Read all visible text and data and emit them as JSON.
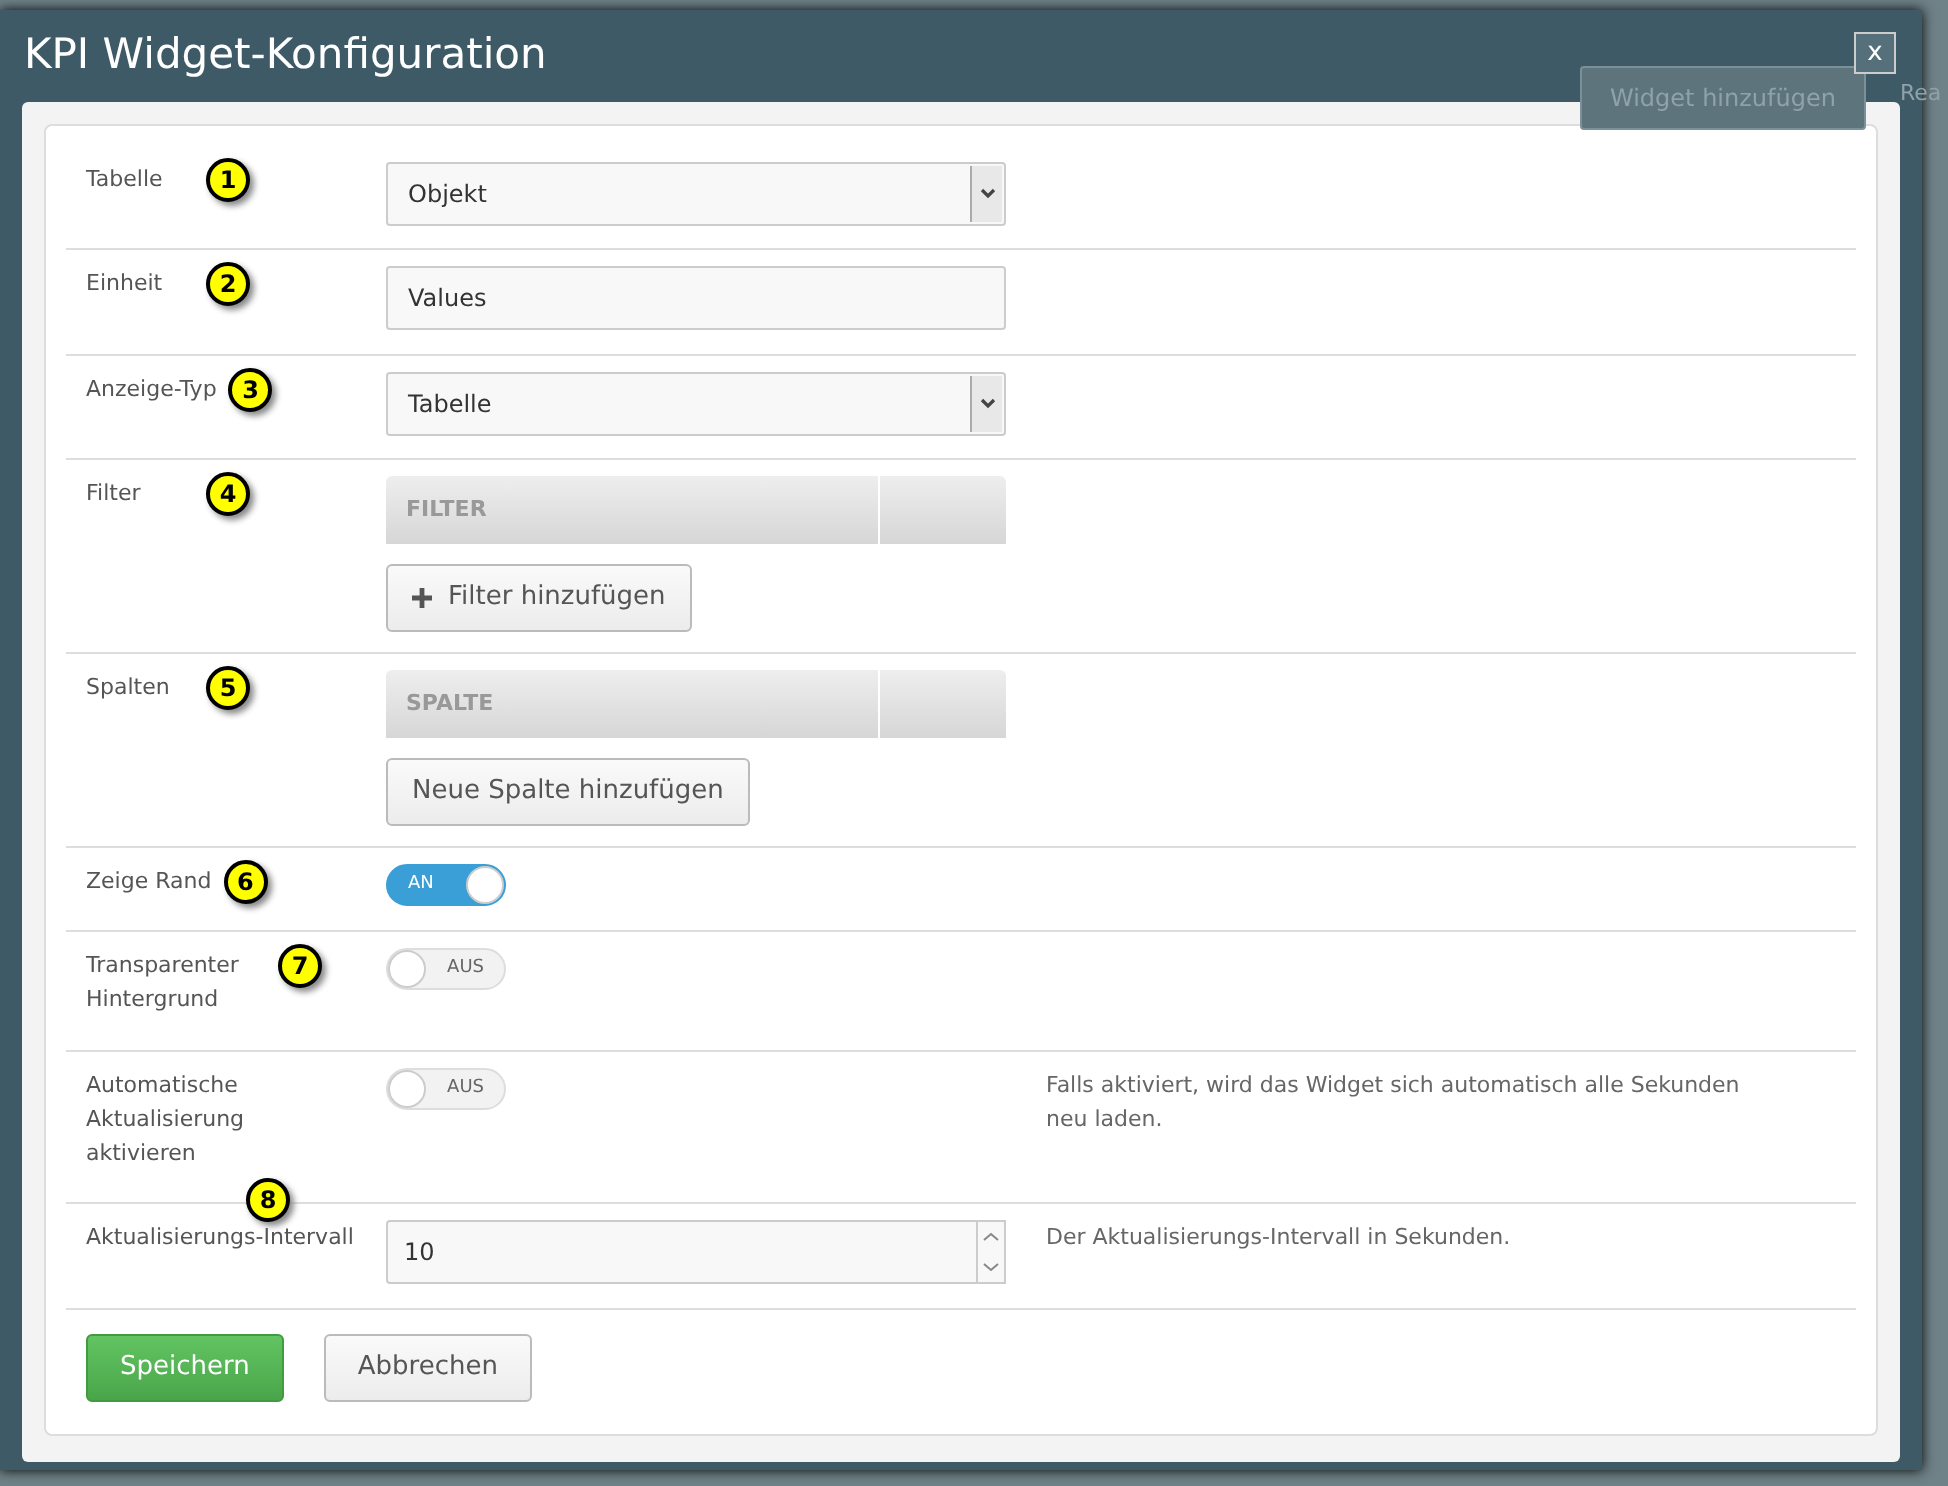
{
  "window": {
    "title": "KPI Widget-Konfiguration",
    "close": "x"
  },
  "background": {
    "button": "Widget hinzufügen",
    "cut_text": "Rea"
  },
  "rows": [
    {
      "kind": "select",
      "label": "Tabelle",
      "marker": "1",
      "value": "Objekt"
    },
    {
      "kind": "text",
      "label": "Einheit",
      "marker": "2",
      "value": "Values"
    },
    {
      "kind": "select",
      "label": "Anzeige-Typ",
      "marker": "3",
      "value": "Tabelle"
    },
    {
      "kind": "list",
      "label": "Filter",
      "marker": "4",
      "header": "FILTER",
      "button": "Filter hinzufügen",
      "add_icon": true
    },
    {
      "kind": "list",
      "label": "Spalten",
      "marker": "5",
      "header": "SPALTE",
      "button": "Neue Spalte hinzufügen",
      "add_icon": false
    },
    {
      "kind": "toggle",
      "label": "Zeige Rand",
      "marker": "6",
      "on": true,
      "text": "AN"
    },
    {
      "kind": "toggle",
      "label": "Transparenter Hintergrund",
      "marker": "7",
      "on": false,
      "text": "AUS"
    },
    {
      "kind": "toggle",
      "label": "Automatische Aktualisierung aktivieren",
      "on": false,
      "text": "AUS",
      "help": "Falls aktiviert, wird das Widget sich automatisch alle Sekunden neu laden."
    },
    {
      "kind": "number",
      "label": "Aktualisierungs-Intervall",
      "marker": "8",
      "value": "10",
      "help": "Der Aktualisierungs-Intervall in Sekunden."
    }
  ],
  "buttons": [
    {
      "label": "Speichern",
      "kind": "primary"
    },
    {
      "label": "Abbrechen",
      "kind": "default"
    }
  ]
}
